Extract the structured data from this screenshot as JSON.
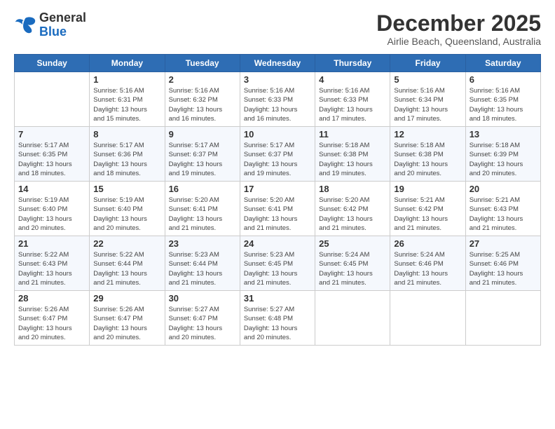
{
  "header": {
    "logo_general": "General",
    "logo_blue": "Blue",
    "month_title": "December 2025",
    "location": "Airlie Beach, Queensland, Australia"
  },
  "days_of_week": [
    "Sunday",
    "Monday",
    "Tuesday",
    "Wednesday",
    "Thursday",
    "Friday",
    "Saturday"
  ],
  "weeks": [
    [
      {
        "day": "",
        "info": ""
      },
      {
        "day": "1",
        "info": "Sunrise: 5:16 AM\nSunset: 6:31 PM\nDaylight: 13 hours\nand 15 minutes."
      },
      {
        "day": "2",
        "info": "Sunrise: 5:16 AM\nSunset: 6:32 PM\nDaylight: 13 hours\nand 16 minutes."
      },
      {
        "day": "3",
        "info": "Sunrise: 5:16 AM\nSunset: 6:33 PM\nDaylight: 13 hours\nand 16 minutes."
      },
      {
        "day": "4",
        "info": "Sunrise: 5:16 AM\nSunset: 6:33 PM\nDaylight: 13 hours\nand 17 minutes."
      },
      {
        "day": "5",
        "info": "Sunrise: 5:16 AM\nSunset: 6:34 PM\nDaylight: 13 hours\nand 17 minutes."
      },
      {
        "day": "6",
        "info": "Sunrise: 5:16 AM\nSunset: 6:35 PM\nDaylight: 13 hours\nand 18 minutes."
      }
    ],
    [
      {
        "day": "7",
        "info": "Sunrise: 5:17 AM\nSunset: 6:35 PM\nDaylight: 13 hours\nand 18 minutes."
      },
      {
        "day": "8",
        "info": "Sunrise: 5:17 AM\nSunset: 6:36 PM\nDaylight: 13 hours\nand 18 minutes."
      },
      {
        "day": "9",
        "info": "Sunrise: 5:17 AM\nSunset: 6:37 PM\nDaylight: 13 hours\nand 19 minutes."
      },
      {
        "day": "10",
        "info": "Sunrise: 5:17 AM\nSunset: 6:37 PM\nDaylight: 13 hours\nand 19 minutes."
      },
      {
        "day": "11",
        "info": "Sunrise: 5:18 AM\nSunset: 6:38 PM\nDaylight: 13 hours\nand 19 minutes."
      },
      {
        "day": "12",
        "info": "Sunrise: 5:18 AM\nSunset: 6:38 PM\nDaylight: 13 hours\nand 20 minutes."
      },
      {
        "day": "13",
        "info": "Sunrise: 5:18 AM\nSunset: 6:39 PM\nDaylight: 13 hours\nand 20 minutes."
      }
    ],
    [
      {
        "day": "14",
        "info": "Sunrise: 5:19 AM\nSunset: 6:40 PM\nDaylight: 13 hours\nand 20 minutes."
      },
      {
        "day": "15",
        "info": "Sunrise: 5:19 AM\nSunset: 6:40 PM\nDaylight: 13 hours\nand 20 minutes."
      },
      {
        "day": "16",
        "info": "Sunrise: 5:20 AM\nSunset: 6:41 PM\nDaylight: 13 hours\nand 21 minutes."
      },
      {
        "day": "17",
        "info": "Sunrise: 5:20 AM\nSunset: 6:41 PM\nDaylight: 13 hours\nand 21 minutes."
      },
      {
        "day": "18",
        "info": "Sunrise: 5:20 AM\nSunset: 6:42 PM\nDaylight: 13 hours\nand 21 minutes."
      },
      {
        "day": "19",
        "info": "Sunrise: 5:21 AM\nSunset: 6:42 PM\nDaylight: 13 hours\nand 21 minutes."
      },
      {
        "day": "20",
        "info": "Sunrise: 5:21 AM\nSunset: 6:43 PM\nDaylight: 13 hours\nand 21 minutes."
      }
    ],
    [
      {
        "day": "21",
        "info": "Sunrise: 5:22 AM\nSunset: 6:43 PM\nDaylight: 13 hours\nand 21 minutes."
      },
      {
        "day": "22",
        "info": "Sunrise: 5:22 AM\nSunset: 6:44 PM\nDaylight: 13 hours\nand 21 minutes."
      },
      {
        "day": "23",
        "info": "Sunrise: 5:23 AM\nSunset: 6:44 PM\nDaylight: 13 hours\nand 21 minutes."
      },
      {
        "day": "24",
        "info": "Sunrise: 5:23 AM\nSunset: 6:45 PM\nDaylight: 13 hours\nand 21 minutes."
      },
      {
        "day": "25",
        "info": "Sunrise: 5:24 AM\nSunset: 6:45 PM\nDaylight: 13 hours\nand 21 minutes."
      },
      {
        "day": "26",
        "info": "Sunrise: 5:24 AM\nSunset: 6:46 PM\nDaylight: 13 hours\nand 21 minutes."
      },
      {
        "day": "27",
        "info": "Sunrise: 5:25 AM\nSunset: 6:46 PM\nDaylight: 13 hours\nand 21 minutes."
      }
    ],
    [
      {
        "day": "28",
        "info": "Sunrise: 5:26 AM\nSunset: 6:47 PM\nDaylight: 13 hours\nand 20 minutes."
      },
      {
        "day": "29",
        "info": "Sunrise: 5:26 AM\nSunset: 6:47 PM\nDaylight: 13 hours\nand 20 minutes."
      },
      {
        "day": "30",
        "info": "Sunrise: 5:27 AM\nSunset: 6:47 PM\nDaylight: 13 hours\nand 20 minutes."
      },
      {
        "day": "31",
        "info": "Sunrise: 5:27 AM\nSunset: 6:48 PM\nDaylight: 13 hours\nand 20 minutes."
      },
      {
        "day": "",
        "info": ""
      },
      {
        "day": "",
        "info": ""
      },
      {
        "day": "",
        "info": ""
      }
    ]
  ]
}
